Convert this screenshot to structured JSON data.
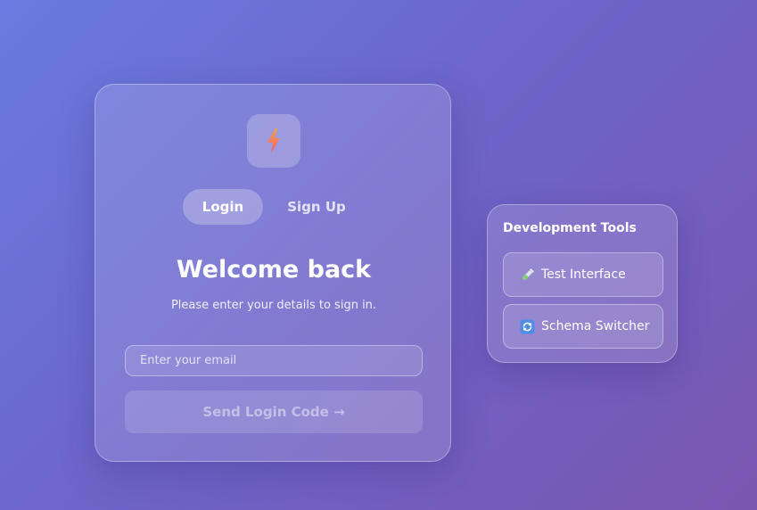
{
  "auth": {
    "logo_icon": "lightning-bolt-icon",
    "tabs": [
      {
        "label": "Login",
        "active": true
      },
      {
        "label": "Sign Up",
        "active": false
      }
    ],
    "title": "Welcome back",
    "subtitle": "Please enter your details to sign in.",
    "email": {
      "value": "",
      "placeholder": "Enter your email"
    },
    "submit_label": "Send Login Code →"
  },
  "dev_tools": {
    "title": "Development Tools",
    "buttons": [
      {
        "label": "Test Interface",
        "icon": "test-tube-icon"
      },
      {
        "label": "Schema Switcher",
        "icon": "refresh-icon"
      }
    ]
  },
  "colors": {
    "background_start": "#6a7be0",
    "background_end": "#7a56b0",
    "bolt_top": "#f7a23b",
    "bolt_bottom": "#ee5a7a",
    "refresh_tile": "#4f8de8"
  }
}
